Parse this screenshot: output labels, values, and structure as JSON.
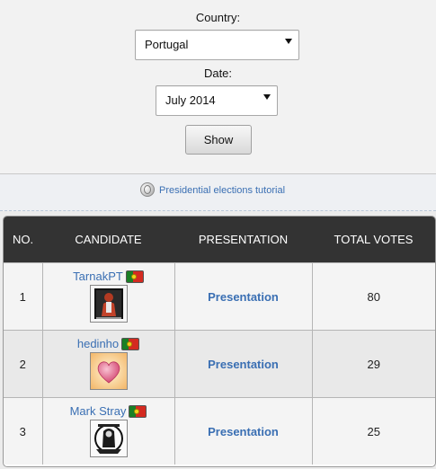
{
  "filters": {
    "country_label": "Country:",
    "country_value": "Portugal",
    "date_label": "Date:",
    "date_value": "July 2014",
    "show_label": "Show"
  },
  "tutorial": {
    "link_text": "Presidential elections tutorial",
    "icon": "globe-icon"
  },
  "table": {
    "headers": [
      "NO.",
      "CANDIDATE",
      "PRESENTATION",
      "TOTAL VOTES"
    ],
    "rows": [
      {
        "no": "1",
        "candidate": "TarnakPT",
        "presentation": "Presentation",
        "votes": "80",
        "avatar": "dark-portrait-avatar"
      },
      {
        "no": "2",
        "candidate": "hedinho",
        "presentation": "Presentation",
        "votes": "29",
        "avatar": "heart-avatar"
      },
      {
        "no": "3",
        "candidate": "Mark Stray",
        "presentation": "Presentation",
        "votes": "25",
        "avatar": "emblem-avatar"
      }
    ]
  },
  "colors": {
    "header_bg": "#333333",
    "link": "#3a6fb3",
    "flag_green": "#1a7f25",
    "flag_red": "#d42a20"
  }
}
